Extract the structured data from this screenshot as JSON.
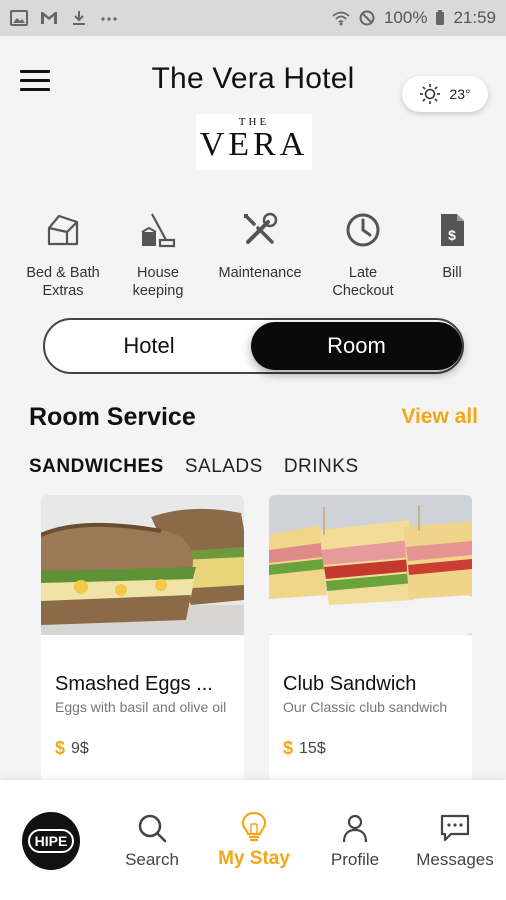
{
  "status_bar": {
    "battery": "100%",
    "time": "21:59"
  },
  "header": {
    "title": "The Vera Hotel",
    "weather_temp": "23°",
    "logo_the": "THE",
    "logo_vera": "VERA"
  },
  "services": [
    {
      "label": "Bed & Bath\nExtras",
      "icon": "bed-bath-icon"
    },
    {
      "label": "House\nkeeping",
      "icon": "housekeeping-icon"
    },
    {
      "label": "Maintenance",
      "icon": "tools-icon"
    },
    {
      "label": "Late\nCheckout",
      "icon": "clock-icon"
    },
    {
      "label": "Bill",
      "icon": "bill-icon"
    }
  ],
  "toggle": {
    "hotel": "Hotel",
    "room": "Room",
    "selected": "Room"
  },
  "room_service": {
    "title": "Room Service",
    "view_all": "View all",
    "categories": [
      "SANDWICHES",
      "SALADS",
      "DRINKS"
    ],
    "active_category": "SANDWICHES",
    "items": [
      {
        "name": "Smashed Eggs ...",
        "description": "Eggs with basil and olive oil",
        "price": "9$"
      },
      {
        "name": "Club Sandwich",
        "description": "Our Classic club sandwich",
        "price": "15$"
      }
    ]
  },
  "bottom_nav": {
    "logo_text": "HIPE",
    "items": [
      {
        "label": "Search",
        "icon": "search-icon"
      },
      {
        "label": "My Stay",
        "icon": "lightbulb-icon",
        "active": true
      },
      {
        "label": "Profile",
        "icon": "person-icon"
      },
      {
        "label": "Messages",
        "icon": "chat-icon"
      }
    ]
  },
  "colors": {
    "accent": "#f2a71b",
    "toggle_active": "#0a0a0a",
    "background": "#f4f4f4"
  }
}
